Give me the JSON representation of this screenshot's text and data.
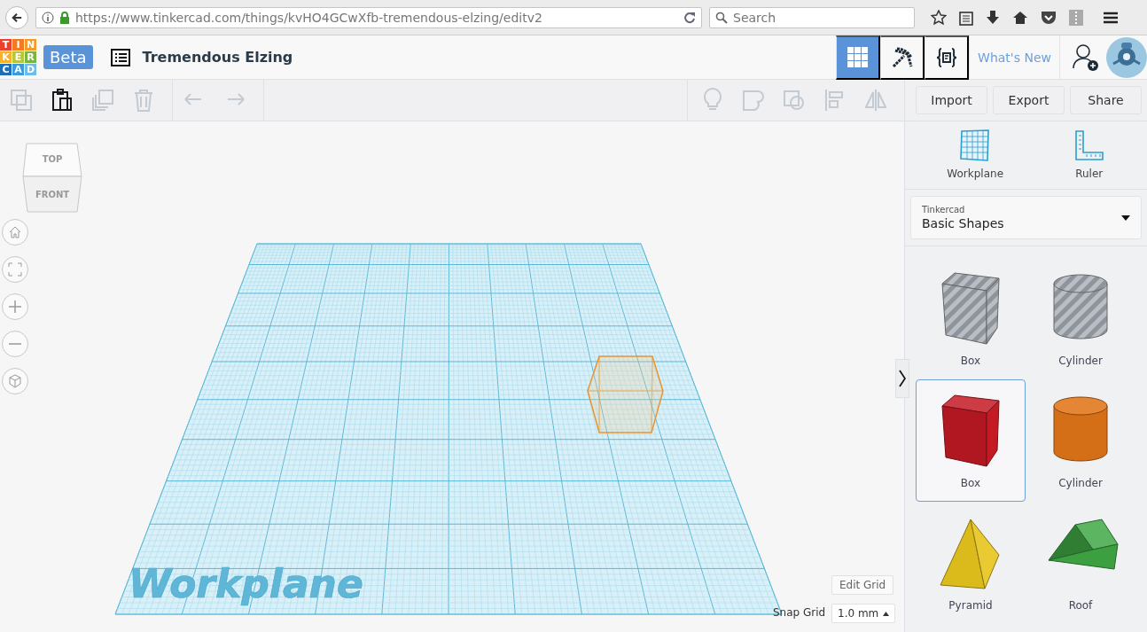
{
  "browser": {
    "url": "https://www.tinkercad.com/things/kvHO4GCwXfb-tremendous-elzing/editv2",
    "search_placeholder": "Search"
  },
  "app_header": {
    "logo_letters": [
      {
        "letter": "T",
        "color": "#e8412c"
      },
      {
        "letter": "I",
        "color": "#f47a22"
      },
      {
        "letter": "N",
        "color": "#f49a2a"
      },
      {
        "letter": "K",
        "color": "#f6b12d"
      },
      {
        "letter": "E",
        "color": "#b8c63a"
      },
      {
        "letter": "R",
        "color": "#7cb342"
      },
      {
        "letter": "C",
        "color": "#1d6fb8"
      },
      {
        "letter": "A",
        "color": "#3b9ad9"
      },
      {
        "letter": "D",
        "color": "#6fbde6"
      }
    ],
    "badge": "Beta",
    "title": "Tremendous Elzing",
    "views": [
      {
        "kind": "grid",
        "selected": true
      },
      {
        "kind": "pickaxe",
        "selected": false
      },
      {
        "kind": "code",
        "selected": false
      }
    ],
    "whats_new": "What's New"
  },
  "toolbar": {
    "left": [
      {
        "kind": "copy",
        "disabled": true
      },
      {
        "kind": "paste",
        "disabled": false
      },
      {
        "kind": "duplicate",
        "disabled": true
      },
      {
        "kind": "delete",
        "disabled": true
      },
      {
        "kind": "undo",
        "disabled": true
      },
      {
        "kind": "redo",
        "disabled": true
      }
    ],
    "right": [
      {
        "kind": "bulb",
        "disabled": true
      },
      {
        "kind": "group",
        "disabled": true
      },
      {
        "kind": "ungroup",
        "disabled": true
      },
      {
        "kind": "align",
        "disabled": true
      },
      {
        "kind": "mirror",
        "disabled": true
      }
    ],
    "buttons": [
      "Import",
      "Export",
      "Share"
    ]
  },
  "view_cube": {
    "top": "TOP",
    "front": "FRONT"
  },
  "nav_buttons": [
    {
      "kind": "home"
    },
    {
      "kind": "fit"
    },
    {
      "kind": "zoom-in"
    },
    {
      "kind": "zoom-out"
    },
    {
      "kind": "perspective"
    }
  ],
  "workplane": {
    "label": "Workplane"
  },
  "grid_controls": {
    "edit_button": "Edit Grid",
    "snap_label": "Snap Grid",
    "snap_value": "1.0 mm"
  },
  "sidebar": {
    "tools": [
      {
        "kind": "workplane",
        "label": "Workplane"
      },
      {
        "kind": "ruler",
        "label": "Ruler"
      }
    ],
    "library": {
      "caption": "Tinkercad",
      "value": "Basic Shapes"
    },
    "shapes": [
      {
        "kind": "box",
        "name": "Box",
        "hole": true,
        "color": "#a9aeb6",
        "selected": false
      },
      {
        "kind": "cylinder",
        "name": "Cylinder",
        "hole": true,
        "color": "#a9aeb6",
        "selected": false
      },
      {
        "kind": "box",
        "name": "Box",
        "hole": false,
        "color": "#c41a24",
        "selected": true
      },
      {
        "kind": "cylinder",
        "name": "Cylinder",
        "hole": false,
        "color": "#e07518",
        "selected": false
      },
      {
        "kind": "pyramid",
        "name": "Pyramid",
        "hole": false,
        "color": "#e6c41c",
        "selected": false
      },
      {
        "kind": "roof",
        "name": "Roof",
        "hole": false,
        "color": "#3fa844",
        "selected": false
      }
    ]
  }
}
